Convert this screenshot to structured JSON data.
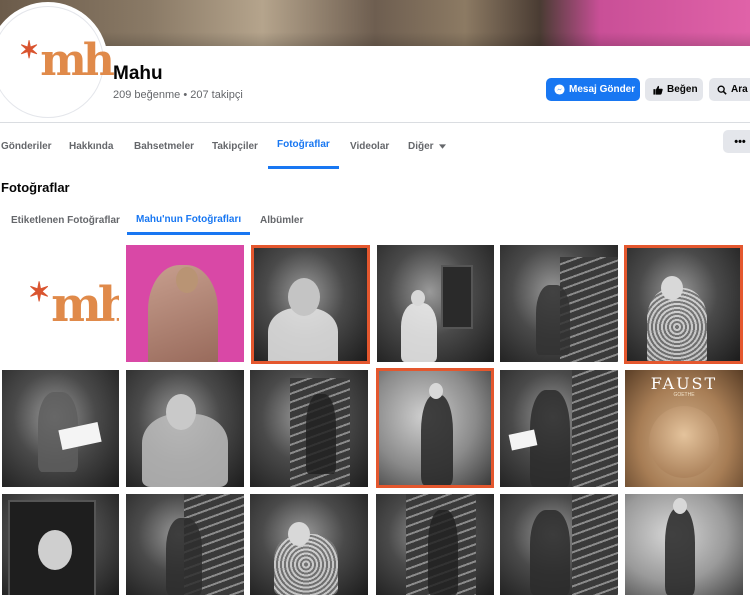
{
  "page": {
    "name": "Mahu",
    "stats": "209 beğenme • 207 takipçi",
    "logo_text": "mh"
  },
  "buttons": {
    "message": "Mesaj Gönder",
    "like": "Beğen",
    "search": "Ara",
    "more": "•••"
  },
  "nav": {
    "tabs": [
      {
        "label": "Gönderiler"
      },
      {
        "label": "Hakkında"
      },
      {
        "label": "Bahsetmeler"
      },
      {
        "label": "Takipçiler"
      },
      {
        "label": "Fotoğraflar"
      },
      {
        "label": "Videolar"
      },
      {
        "label": "Diğer"
      }
    ],
    "active": "Fotoğraflar"
  },
  "photos": {
    "title": "Fotoğraflar",
    "tabs": [
      {
        "label": "Etiketlenen Fotoğraflar"
      },
      {
        "label": "Mahu'nun Fotoğrafları"
      },
      {
        "label": "Albümler"
      }
    ],
    "active_tab": "Mahu'nun Fotoğrafları",
    "book_cover": {
      "title": "FAUST",
      "subtitle": "GOETHE"
    }
  },
  "colors": {
    "accent": "#1877f2",
    "highlight": "#e4572e",
    "logo": "#e08a4a",
    "pink": "#d948a6"
  }
}
